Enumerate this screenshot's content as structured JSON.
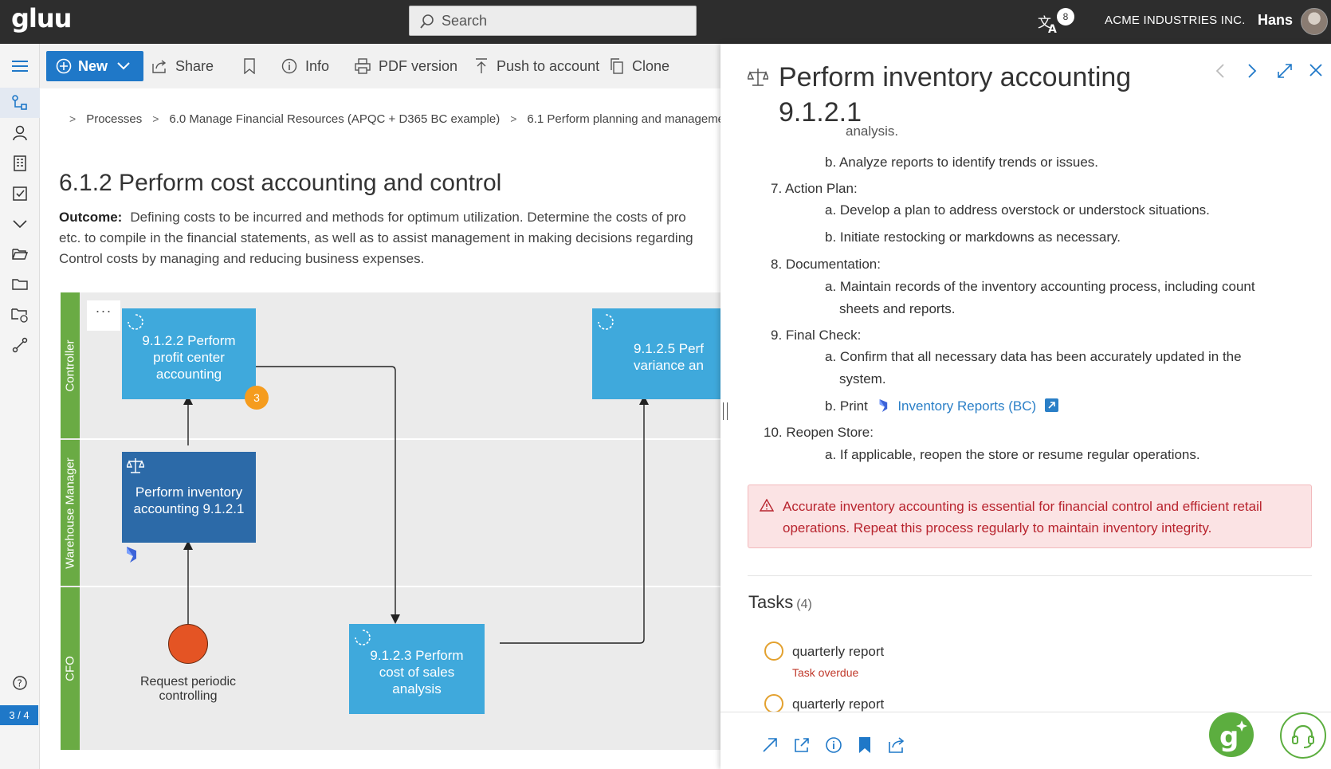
{
  "app": {
    "logo": "gluu",
    "search_placeholder": "Search",
    "notification_count": "8",
    "company": "ACME INDUSTRIES INC.",
    "user": "Hans",
    "page_counter": "3 / 4"
  },
  "toolbar": {
    "new_label": "New",
    "share_label": "Share",
    "info_label": "Info",
    "pdf_label": "PDF version",
    "push_label": "Push to account",
    "clone_label": "Clone"
  },
  "breadcrumb": [
    "Processes",
    "6.0 Manage Financial Resources (APQC + D365 BC example)",
    "6.1 Perform planning and manageme"
  ],
  "page": {
    "title": "6.1.2 Perform cost accounting and control",
    "outcome_label": "Outcome:",
    "outcome_lines": [
      "Defining costs to be incurred and methods for optimum utilization. Determine the costs of pro",
      "etc. to compile in the financial statements, as well as to assist management in making decisions regarding",
      "Control costs by managing and reducing business expenses."
    ]
  },
  "diagram": {
    "lanes": [
      "Controller",
      "Warehouse Manager",
      "CFO"
    ],
    "menu_label": "···",
    "boxes": {
      "b9122": "9.1.2.2 Perform profit center accounting",
      "b9121": "Perform inventory accounting 9.1.2.1",
      "b9125": "9.1.2.5 Perf variance an",
      "b9123": "9.1.2.3 Perform cost of sales analysis"
    },
    "badge_count": "3",
    "event_label_1": "Request periodic",
    "event_label_2": "controlling"
  },
  "panel": {
    "title_line1": "Perform inventory accounting",
    "title_line2": "9.1.2.1",
    "content": {
      "cut_line": "analysis.",
      "l6b": "b. Analyze reports to identify trends or issues.",
      "l7": "7. Action Plan:",
      "l7a": "a. Develop a plan to address overstock or understock situations.",
      "l7b": "b. Initiate restocking or markdowns as necessary.",
      "l8": "8. Documentation:",
      "l8a_1": "a. Maintain records of the inventory accounting process, including count",
      "l8a_2": "sheets and reports.",
      "l9": "9. Final Check:",
      "l9a_1": "a. Confirm that all necessary data has been accurately updated in the",
      "l9a_2": "system.",
      "l9b_prefix": "b. Print",
      "l9b_link": "Inventory Reports (BC)",
      "l10": "10. Reopen Store:",
      "l10a": "a. If applicable, reopen the store or resume regular operations."
    },
    "warning_line1": "Accurate inventory accounting is essential for financial control and efficient retail",
    "warning_line2": "operations. Repeat this process regularly to maintain inventory integrity.",
    "tasks_title": "Tasks",
    "tasks_count": "(4)",
    "tasks": [
      {
        "name": "quarterly report",
        "status": "Task overdue"
      },
      {
        "name": "quarterly report",
        "status": ""
      }
    ]
  },
  "colors": {
    "topbar": "#2d2d2d",
    "primary": "#1f78c8",
    "lane_green": "#6aab44",
    "box_light": "#3fa9dc",
    "box_dark": "#2c6aa8",
    "warning_bg": "#fbe3e4",
    "warning_text": "#b8242e",
    "link": "#2a7fc7"
  }
}
